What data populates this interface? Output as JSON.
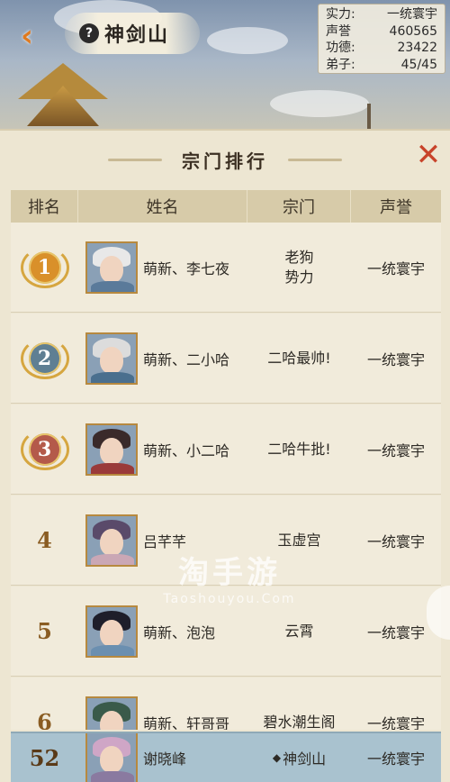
{
  "header": {
    "sect_name": "神剑山",
    "help_glyph": "?"
  },
  "stats": [
    {
      "label": "实力:",
      "value": "一统寰宇"
    },
    {
      "label": "声誉",
      "value": "460565"
    },
    {
      "label": "功德:",
      "value": "23422"
    },
    {
      "label": "弟子:",
      "value": "45/45"
    }
  ],
  "panel": {
    "title": "宗门排行",
    "columns": [
      "排名",
      "姓名",
      "宗门",
      "声誉"
    ]
  },
  "rows": [
    {
      "rank": "1",
      "name": "萌新、李七夜",
      "sect": "老狗\n势力",
      "fame": "一统寰宇",
      "hair": "#e8e8e8",
      "robe": "#5a7a9a"
    },
    {
      "rank": "2",
      "name": "萌新、二小哈",
      "sect": "二哈最帅!",
      "fame": "一统寰宇",
      "hair": "#dcdcdc",
      "robe": "#4a6f8e"
    },
    {
      "rank": "3",
      "name": "萌新、小二哈",
      "sect": "二哈牛批!",
      "fame": "一统寰宇",
      "hair": "#3a2a2a",
      "robe": "#9a3a3a"
    },
    {
      "rank": "4",
      "name": "吕芊芊",
      "sect": "玉虚宫",
      "fame": "一统寰宇",
      "hair": "#5a4a6a",
      "robe": "#caa7b5"
    },
    {
      "rank": "5",
      "name": "萌新、泡泡",
      "sect": "云霄",
      "fame": "一统寰宇",
      "hair": "#1e1e2a",
      "robe": "#6b8fb0"
    },
    {
      "rank": "6",
      "name": "萌新、轩哥哥",
      "sect": "碧水潮生阁",
      "fame": "一统寰宇",
      "hair": "#3a5a4a",
      "robe": "#7a6a4a"
    }
  ],
  "my_rank": {
    "rank": "52",
    "name": "谢晓峰",
    "sect": "神剑山",
    "fame": "一统寰宇",
    "hair": "#cfa6c6",
    "robe": "#8a7aa0"
  },
  "watermark": {
    "main": "淘手游",
    "sub": "Taoshouyou.Com"
  },
  "medal_colors": {
    "1": "#d9902a",
    "2": "#5f7f93",
    "3": "#b45a4a"
  }
}
